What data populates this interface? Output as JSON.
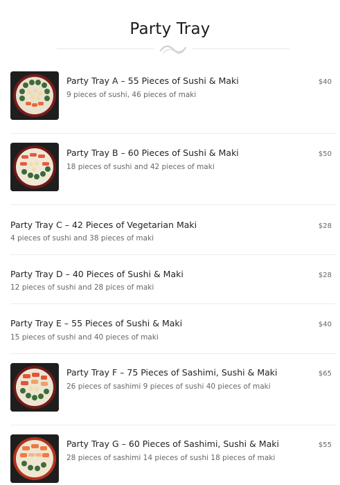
{
  "page": {
    "title": "Party Tray"
  },
  "items": [
    {
      "name": "Party Tray A – 55 Pieces of Sushi & Maki",
      "description": "9 pieces of sushi, 46 pieces of maki",
      "price": "$40",
      "has_image": true
    },
    {
      "name": "Party Tray B – 60 Pieces of Sushi & Maki",
      "description": "18 pieces of sushi and 42 pieces of maki",
      "price": "$50",
      "has_image": true
    },
    {
      "name": "Party Tray C – 42 Pieces of Vegetarian Maki",
      "description": "4 pieces of sushi and 38 pieces of maki",
      "price": "$28",
      "has_image": false
    },
    {
      "name": "Party Tray D – 40 Pieces of Sushi & Maki",
      "description": "12 pieces of sushi and 28 pices of maki",
      "price": "$28",
      "has_image": false
    },
    {
      "name": "Party Tray E – 55 Pieces of Sushi & Maki",
      "description": "15 pieces of sushi and 40 pieces of maki",
      "price": "$40",
      "has_image": false
    },
    {
      "name": "Party Tray F – 75 Pieces of Sashimi, Sushi & Maki",
      "description": "26 pieces of sashimi 9 pieces of sushi 40 pieces of maki",
      "price": "$65",
      "has_image": true
    },
    {
      "name": "Party Tray G – 60 Pieces of Sashimi, Sushi & Maki",
      "description": "28 pieces of sashimi 14 pieces of sushi 18 pieces of maki",
      "price": "$55",
      "has_image": true
    }
  ],
  "colors": {
    "title": "#1c1c1c",
    "divider_ornament": "#cfcfcf",
    "row_border": "#ececec"
  },
  "icons": {
    "divider": "wave-ornament-icon"
  }
}
